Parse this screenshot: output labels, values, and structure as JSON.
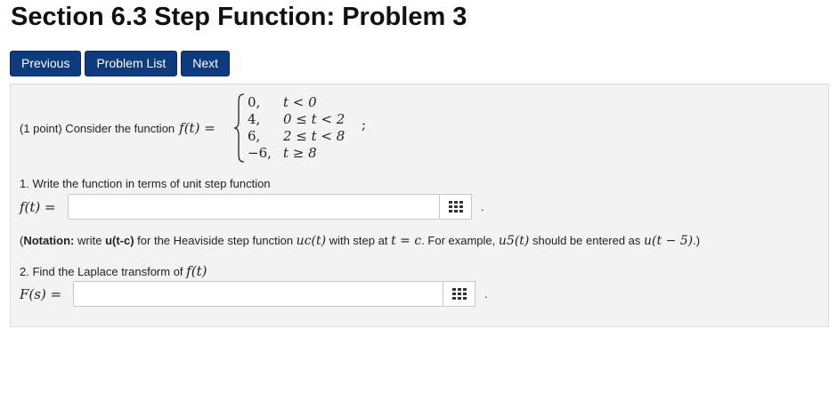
{
  "page": {
    "title": "Section 6.3 Step Function: Problem 3"
  },
  "nav": {
    "previous": "Previous",
    "problem_list": "Problem List",
    "next": "Next"
  },
  "problem": {
    "points": "(1 point) Consider the function",
    "f_of_t": "f(t) =",
    "piecewise": [
      {
        "value": "0,",
        "condition": "t < 0"
      },
      {
        "value": "4,",
        "condition": "0 ≤ t < 2"
      },
      {
        "value": "6,",
        "condition": "2 ≤ t < 8"
      },
      {
        "value": "−6,",
        "condition": "t ≥ 8"
      }
    ],
    "piecewise_end": ";",
    "q1": {
      "label": "1. Write the function in terms of unit step function",
      "answer_label": "f(t) =",
      "value": "",
      "period": "."
    },
    "notation": {
      "prefix": "(",
      "bold": "Notation:",
      "part1": " write ",
      "code": "u(t-c)",
      "part2": " for the Heaviside step function ",
      "math_uc": "uc(t)",
      "part3": " with step at ",
      "math_tc": "t = c",
      "part4": ". For example, ",
      "math_u5": "u5(t)",
      "part5": " should be entered as ",
      "math_example": "u(t − 5)",
      "suffix": ".)"
    },
    "q2": {
      "label": "2. Find the Laplace transform of",
      "label_math": "f(t)",
      "answer_label": "F(s) =",
      "value": "",
      "period": "."
    }
  }
}
